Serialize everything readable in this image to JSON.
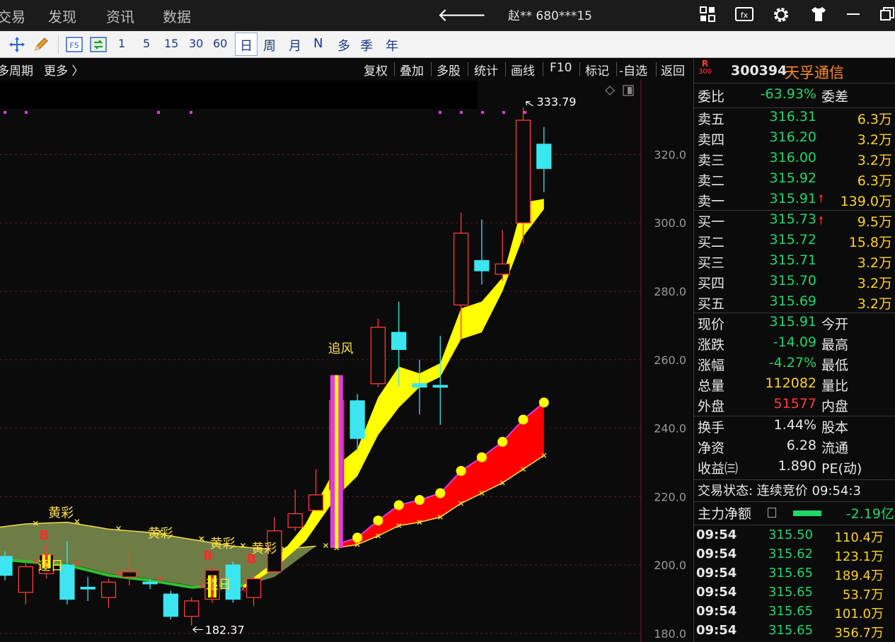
{
  "topbar": {
    "nav": [
      "交易",
      "发现",
      "资讯",
      "数据"
    ],
    "account": "赵** 680***15",
    "icons": [
      "grid-icon",
      "f10-icon",
      "gear-icon",
      "shirt-icon",
      "minimize-icon",
      "restore-icon"
    ]
  },
  "toolbar": {
    "items": [
      "1",
      "5",
      "15",
      "30",
      "60"
    ],
    "periods": [
      "日",
      "周",
      "月",
      "N",
      "多",
      "季",
      "年"
    ],
    "f5": "F5"
  },
  "chart_header": {
    "left": "多周期",
    "more": "更多 〉",
    "buttons": [
      "复权",
      "叠加",
      "多股",
      "统计",
      "画线",
      "F10",
      "标记",
      "-自选",
      "返回"
    ]
  },
  "chart_data": {
    "type": "candlestick",
    "y_ticks": [
      180.0,
      200.0,
      220.0,
      240.0,
      260.0,
      280.0,
      300.0,
      320.0
    ],
    "y_tick_labels": [
      "180.0",
      "200.0",
      "220.0",
      "240.0",
      "260.0",
      "280.0",
      "300.0",
      "320.0"
    ],
    "ylim": [
      177.5,
      342.0
    ],
    "high_label": "333.79",
    "low_label": "182.37",
    "annotations": [
      "黄彩",
      "黄彩",
      "黄彩",
      "黄彩",
      "逐日",
      "逐日",
      "追风",
      "B",
      "B",
      "B"
    ],
    "candles": [
      {
        "o": 202.5,
        "c": 197.0,
        "h": 204.0,
        "l": 195.5
      },
      {
        "o": 192.0,
        "c": 199.5,
        "h": 201.0,
        "l": 188.5
      },
      {
        "o": 197.5,
        "c": 203.0,
        "h": 206.0,
        "l": 196.0
      },
      {
        "o": 200.0,
        "c": 190.0,
        "h": 207.0,
        "l": 188.5
      },
      {
        "o": 193.5,
        "c": 193.0,
        "h": 196.5,
        "l": 189.5
      },
      {
        "o": 190.5,
        "c": 195.0,
        "h": 196.0,
        "l": 187.5
      },
      {
        "o": 196.5,
        "c": 198.0,
        "h": 204.0,
        "l": 194.0
      },
      {
        "o": 195.0,
        "c": 194.5,
        "h": 196.0,
        "l": 193.0
      },
      {
        "o": 191.5,
        "c": 185.0,
        "h": 192.5,
        "l": 184.0
      },
      {
        "o": 185.0,
        "c": 189.5,
        "h": 190.5,
        "l": 182.37
      },
      {
        "o": 190.0,
        "c": 198.5,
        "h": 200.0,
        "l": 189.0
      },
      {
        "o": 200.0,
        "c": 190.0,
        "h": 201.0,
        "l": 189.0
      },
      {
        "o": 190.5,
        "c": 196.0,
        "h": 198.0,
        "l": 188.0
      },
      {
        "o": 198.0,
        "c": 210.0,
        "h": 214.0,
        "l": 198.0
      },
      {
        "o": 211.0,
        "c": 215.0,
        "h": 222.0,
        "l": 210.0
      },
      {
        "o": 216.0,
        "c": 220.5,
        "h": 228.0,
        "l": 216.0
      },
      {
        "o": 222.0,
        "c": 248.0,
        "h": 251.0,
        "l": 220.0
      },
      {
        "o": 248.0,
        "c": 237.0,
        "h": 250.0,
        "l": 233.0
      },
      {
        "o": 253.0,
        "c": 269.5,
        "h": 272.0,
        "l": 252.0
      },
      {
        "o": 268.0,
        "c": 263.0,
        "h": 277.0,
        "l": 252.0
      },
      {
        "o": 253.0,
        "c": 252.0,
        "h": 260.0,
        "l": 244.0
      },
      {
        "o": 252.5,
        "c": 252.0,
        "h": 267.0,
        "l": 241.0
      },
      {
        "o": 276.0,
        "c": 297.0,
        "h": 303.0,
        "l": 266.0
      },
      {
        "o": 289.0,
        "c": 286.0,
        "h": 301.0,
        "l": 282.0
      },
      {
        "o": 285.0,
        "c": 288.0,
        "h": 298.0,
        "l": 283.0
      },
      {
        "o": 300.0,
        "c": 330.0,
        "h": 333.79,
        "l": 294.0
      },
      {
        "o": 323.0,
        "c": 315.91,
        "h": 328.0,
        "l": 309.0
      }
    ]
  },
  "panel": {
    "r_label": "R",
    "r_sub": "300",
    "code": "300394",
    "name": "天孚通信",
    "weibi_label": "委比",
    "weibi_value": "-63.93%",
    "weicha_label": "委差",
    "sell": [
      {
        "label": "卖五",
        "price": "316.31",
        "vol": "6.3万"
      },
      {
        "label": "卖四",
        "price": "316.20",
        "vol": "3.2万"
      },
      {
        "label": "卖三",
        "price": "316.00",
        "vol": "3.2万"
      },
      {
        "label": "卖二",
        "price": "315.92",
        "vol": "6.3万"
      },
      {
        "label": "卖一",
        "price": "315.91",
        "vol": "139.0万"
      }
    ],
    "buy": [
      {
        "label": "买一",
        "price": "315.73",
        "vol": "9.5万"
      },
      {
        "label": "买二",
        "price": "315.72",
        "vol": "15.8万"
      },
      {
        "label": "买三",
        "price": "315.71",
        "vol": "3.2万"
      },
      {
        "label": "买四",
        "price": "315.70",
        "vol": "3.2万"
      },
      {
        "label": "买五",
        "price": "315.69",
        "vol": "3.2万"
      }
    ],
    "quote": [
      {
        "label": "现价",
        "value": "315.91",
        "label2": "今开",
        "color": "#22d66a"
      },
      {
        "label": "涨跌",
        "value": "-14.09",
        "label2": "最高",
        "color": "#22d66a"
      },
      {
        "label": "涨幅",
        "value": "-4.27%",
        "label2": "最低",
        "color": "#22d66a"
      },
      {
        "label": "总量",
        "value": "112082",
        "label2": "量比",
        "color": "#ffd21f"
      },
      {
        "label": "外盘",
        "value": "51577",
        "label2": "内盘",
        "color": "#ff3b3b"
      }
    ],
    "info": [
      {
        "label": "换手",
        "value": "1.44%",
        "label2": "股本"
      },
      {
        "label": "净资",
        "value": "6.28",
        "label2": "流通"
      },
      {
        "label": "收益㈢",
        "value": "1.890",
        "label2": "PE(动)"
      }
    ],
    "trade_status": "交易状态: 连续竞价 09:54:3",
    "main_flow_label": "主力净额",
    "main_flow_value": "-2.19亿",
    "ticks": [
      {
        "time": "09:54",
        "price": "315.50",
        "vol": "110.4万"
      },
      {
        "time": "09:54",
        "price": "315.62",
        "vol": "123.1万"
      },
      {
        "time": "09:54",
        "price": "315.65",
        "vol": "189.4万"
      },
      {
        "time": "09:54",
        "price": "315.65",
        "vol": "53.7万"
      },
      {
        "time": "09:54",
        "price": "315.65",
        "vol": "101.0万"
      },
      {
        "time": "09:54",
        "price": "315.65",
        "vol": "356.7万"
      }
    ]
  }
}
